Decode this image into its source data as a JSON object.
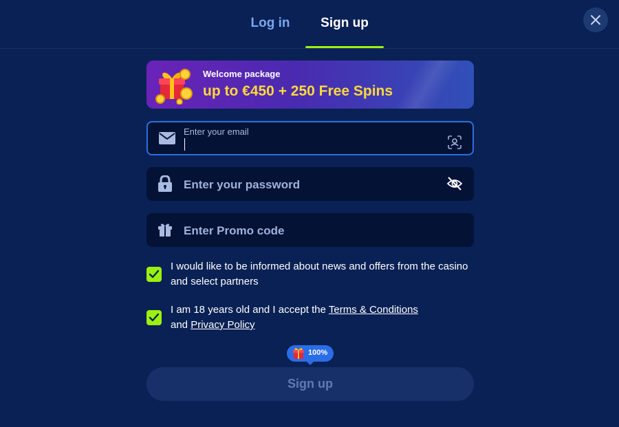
{
  "tabs": [
    {
      "label": "Log in",
      "active": false
    },
    {
      "label": "Sign up",
      "active": true
    }
  ],
  "colors": {
    "background": "#0a2155",
    "accent": "#9cf010",
    "focus_border": "#2b6fe0",
    "promo_highlight": "#ffd93a",
    "field_bg": "#041235"
  },
  "promo": {
    "small": "Welcome package",
    "big": "up to €450 + 250 Free Spins",
    "icon": "gift-box-icon"
  },
  "form": {
    "email": {
      "label": "Enter your email",
      "value": "",
      "icon": "mail-icon",
      "trail_icon": "face-scan-icon"
    },
    "password": {
      "placeholder": "Enter your password",
      "value": "",
      "icon": "lock-icon",
      "trail_icon": "eye-off-icon"
    },
    "promo_code": {
      "placeholder": "Enter Promo code",
      "value": "",
      "icon": "gift-icon"
    }
  },
  "consents": {
    "news": {
      "checked": true,
      "text": "I would like to be informed about news and offers from the casino and select partners"
    },
    "age": {
      "checked": true,
      "text_before": "I am 18 years old and I accept the ",
      "terms_link": "Terms & Conditions",
      "text_middle": "and ",
      "privacy_link": "Privacy Policy"
    }
  },
  "progress_badge": {
    "label": "100%",
    "value": 100
  },
  "submit": {
    "label": "Sign up",
    "enabled": false
  }
}
